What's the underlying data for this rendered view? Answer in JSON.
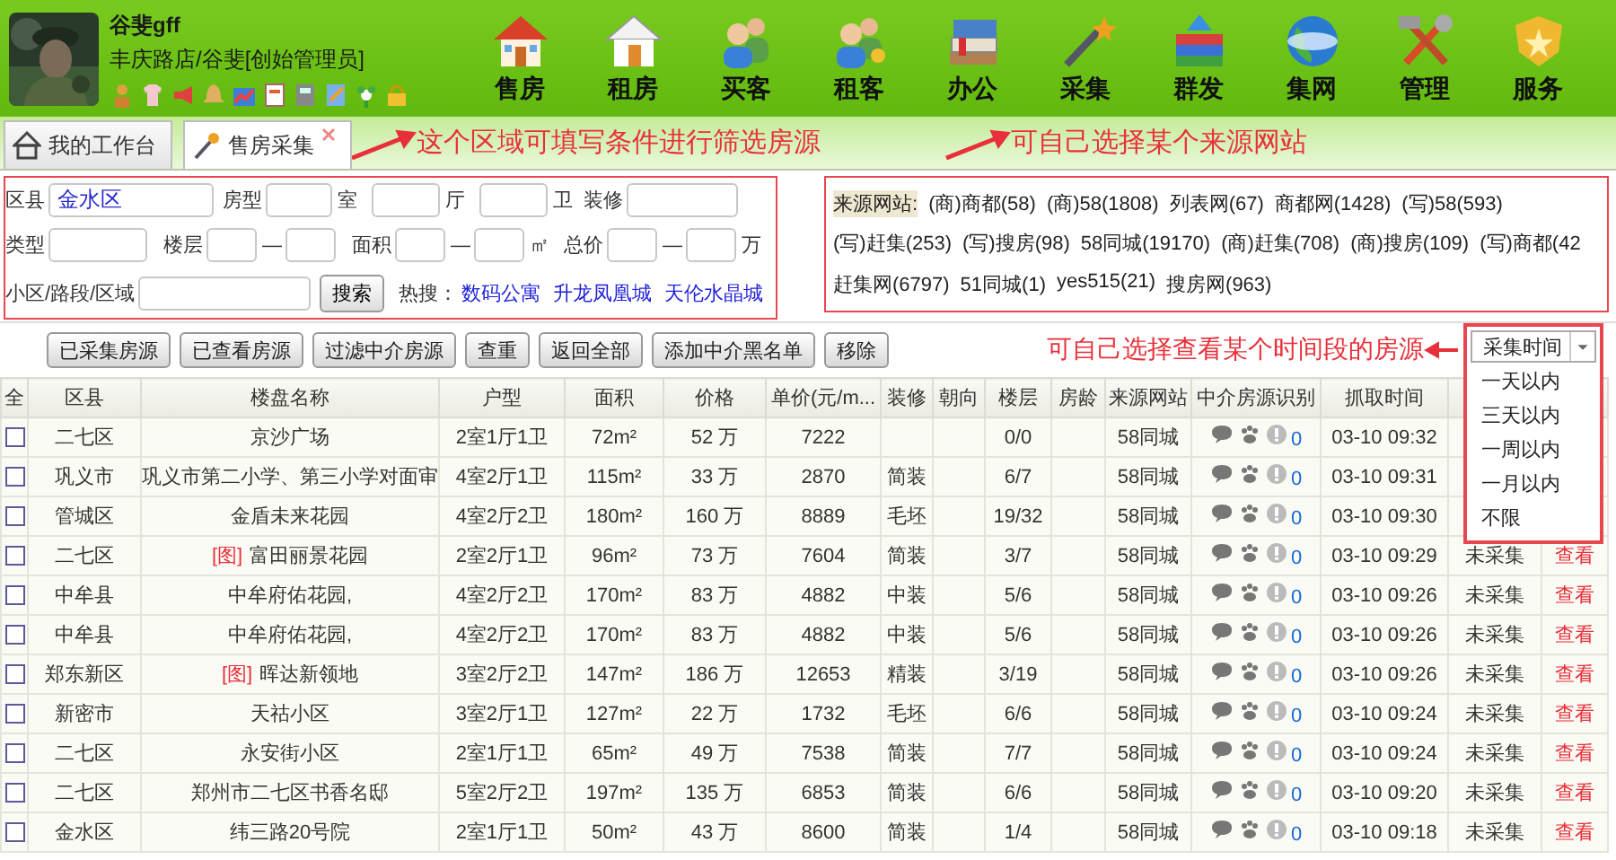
{
  "user": {
    "name": "谷斐gff",
    "store": "丰庆路店/谷斐[创始管理员]"
  },
  "nav": [
    {
      "label": "售房",
      "kind": "house"
    },
    {
      "label": "租房",
      "kind": "house_plain"
    },
    {
      "label": "买客",
      "kind": "people"
    },
    {
      "label": "租客",
      "kind": "people_key"
    },
    {
      "label": "办公",
      "kind": "books"
    },
    {
      "label": "采集",
      "kind": "wand"
    },
    {
      "label": "群发",
      "kind": "stack"
    },
    {
      "label": "集网",
      "kind": "globe"
    },
    {
      "label": "管理",
      "kind": "tools"
    },
    {
      "label": "服务",
      "kind": "badge"
    }
  ],
  "tabs": [
    {
      "label": "我的工作台",
      "kind": "home",
      "selected": false,
      "closable": false
    },
    {
      "label": "售房采集",
      "kind": "wand",
      "selected": true,
      "closable": true
    }
  ],
  "annotations": [
    "这个区域可填写条件进行筛选房源",
    "可自己选择某个来源网站",
    "可自己选择查看某个时间段的房源"
  ],
  "filter_form": {
    "district": {
      "label": "区县",
      "value": "金水区"
    },
    "room_type": {
      "label": "房型",
      "units": [
        "室",
        "厅",
        "卫"
      ]
    },
    "decoration": {
      "label": "装修"
    },
    "type": {
      "label": "类型"
    },
    "floor": {
      "label": "楼层",
      "separator": "—"
    },
    "area": {
      "label": "面积",
      "separator": "—",
      "unit": "㎡"
    },
    "total_price": {
      "label": "总价",
      "separator": "—",
      "unit": "万"
    },
    "community": {
      "label": "小区/路段/区域"
    },
    "search_button": "搜索",
    "hot_search": {
      "label": "热搜：",
      "links": [
        "数码公寓",
        "升龙凤凰城",
        "天伦水晶城"
      ]
    }
  },
  "source_sites": {
    "label": "来源网站:",
    "lines": [
      [
        "(商)商都(58)",
        "(商)58(1808)",
        "列表网(67)",
        "商都网(1428)",
        "(写)58(593)"
      ],
      [
        "(写)赶集(253)",
        "(写)搜房(98)",
        "58同城(19170)",
        "(商)赶集(708)",
        "(商)搜房(109)",
        "(写)商都(42"
      ],
      [
        "赶集网(6797)",
        "51同城(1)",
        "yes515(21)",
        "搜房网(963)"
      ]
    ]
  },
  "buttons": [
    "已采集房源",
    "已查看房源",
    "过滤中介房源",
    "查重",
    "返回全部",
    "添加中介黑名单",
    "移除"
  ],
  "time_filter": {
    "label": "采集时间",
    "expanded": true,
    "options": [
      {
        "label": "一天以内",
        "selected": false
      },
      {
        "label": "三天以内",
        "selected": false
      },
      {
        "label": "一周以内",
        "selected": false
      },
      {
        "label": "一月以内",
        "selected": false
      },
      {
        "label": "不限",
        "selected": false
      }
    ]
  },
  "table": {
    "columns": [
      "全",
      "区县",
      "楼盘名称",
      "户型",
      "面积",
      "价格",
      "单价(元/m...",
      "装修",
      "朝向",
      "楼层",
      "房龄",
      "来源网站",
      "中介房源识别",
      "抓取时间"
    ],
    "rows": [
      {
        "checked": false,
        "district": "二七区",
        "name": "京沙广场",
        "layout": "2室1厅1卫",
        "area": "72m²",
        "price": "52 万",
        "unit_price": "7222",
        "floor": "0/0",
        "source": "58同城",
        "agent_count": "0",
        "time": "03-10 09:32"
      },
      {
        "checked": false,
        "district": "巩义市",
        "name": "巩义市第二小学、第三小学对面审",
        "layout": "4室2厅1卫",
        "area": "115m²",
        "price": "33 万",
        "unit_price": "2870",
        "decoration": "简装",
        "floor": "6/7",
        "source": "58同城",
        "agent_count": "0",
        "time": "03-10 09:31"
      },
      {
        "checked": false,
        "district": "管城区",
        "name": "金盾未来花园",
        "layout": "4室2厅2卫",
        "area": "180m²",
        "price": "160 万",
        "unit_price": "8889",
        "decoration": "毛坯",
        "floor": "19/32",
        "source": "58同城",
        "agent_count": "0",
        "time": "03-10 09:30"
      },
      {
        "checked": false,
        "district": "二七区",
        "photo_tag": "[图]",
        "name": "富田丽景花园",
        "layout": "2室2厅1卫",
        "area": "96m²",
        "price": "73 万",
        "unit_price": "7604",
        "decoration": "简装",
        "floor": "3/7",
        "source": "58同城",
        "agent_count": "0",
        "time": "03-10 09:29",
        "status": "未采集",
        "action": "查看"
      },
      {
        "checked": false,
        "district": "中牟县",
        "name": "中牟府佑花园,",
        "layout": "4室2厅2卫",
        "area": "170m²",
        "price": "83 万",
        "unit_price": "4882",
        "decoration": "中装",
        "floor": "5/6",
        "source": "58同城",
        "agent_count": "0",
        "time": "03-10 09:26",
        "status": "未采集",
        "action": "查看"
      },
      {
        "checked": false,
        "district": "中牟县",
        "name": "中牟府佑花园,",
        "layout": "4室2厅2卫",
        "area": "170m²",
        "price": "83 万",
        "unit_price": "4882",
        "decoration": "中装",
        "floor": "5/6",
        "source": "58同城",
        "agent_count": "0",
        "time": "03-10 09:26",
        "status": "未采集",
        "action": "查看"
      },
      {
        "checked": false,
        "district": "郑东新区",
        "photo_tag": "[图]",
        "name": "晖达新领地",
        "layout": "3室2厅2卫",
        "area": "147m²",
        "price": "186 万",
        "unit_price": "12653",
        "decoration": "精装",
        "floor": "3/19",
        "source": "58同城",
        "agent_count": "0",
        "time": "03-10 09:26",
        "status": "未采集",
        "action": "查看"
      },
      {
        "checked": false,
        "district": "新密市",
        "name": "天祜小区",
        "layout": "3室2厅1卫",
        "area": "127m²",
        "price": "22 万",
        "unit_price": "1732",
        "decoration": "毛坯",
        "floor": "6/6",
        "source": "58同城",
        "agent_count": "0",
        "time": "03-10 09:24",
        "status": "未采集",
        "action": "查看"
      },
      {
        "checked": false,
        "district": "二七区",
        "name": "永安街小区",
        "layout": "2室1厅1卫",
        "area": "65m²",
        "price": "49 万",
        "unit_price": "7538",
        "decoration": "简装",
        "floor": "7/7",
        "source": "58同城",
        "agent_count": "0",
        "time": "03-10 09:24",
        "status": "未采集",
        "action": "查看"
      },
      {
        "checked": false,
        "district": "二七区",
        "name": "郑州市二七区书香名邸",
        "layout": "5室2厅2卫",
        "area": "197m²",
        "price": "135 万",
        "unit_price": "6853",
        "decoration": "简装",
        "floor": "6/6",
        "source": "58同城",
        "agent_count": "0",
        "time": "03-10 09:20",
        "status": "未采集",
        "action": "查看"
      },
      {
        "checked": false,
        "district": "金水区",
        "name": "纬三路20号院",
        "layout": "2室1厅1卫",
        "area": "50m²",
        "price": "43 万",
        "unit_price": "8600",
        "decoration": "简装",
        "floor": "1/4",
        "source": "58同城",
        "agent_count": "0",
        "time": "03-10 09:18",
        "status": "未采集",
        "action": "查看"
      }
    ]
  }
}
